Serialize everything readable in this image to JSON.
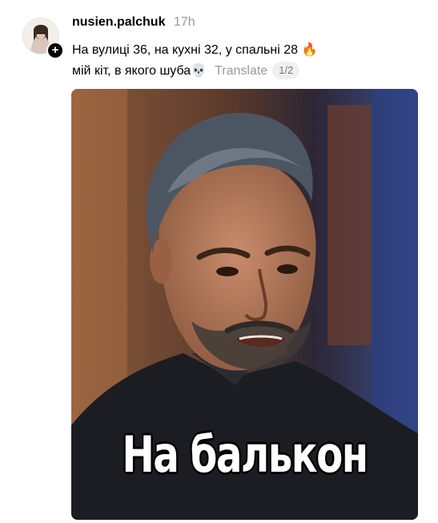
{
  "post": {
    "username": "nusien.palchuk",
    "time": "17h",
    "caption_line1": "На вулиці 36, на кухні 32, у спальні 28 🔥",
    "caption_line2": "мій кіт, в якого шуба💀",
    "translate_label": "Translate",
    "page_indicator": "1/2"
  },
  "media": {
    "overlay_text": "На балькон",
    "image_description_icon": "photo-of-man"
  }
}
